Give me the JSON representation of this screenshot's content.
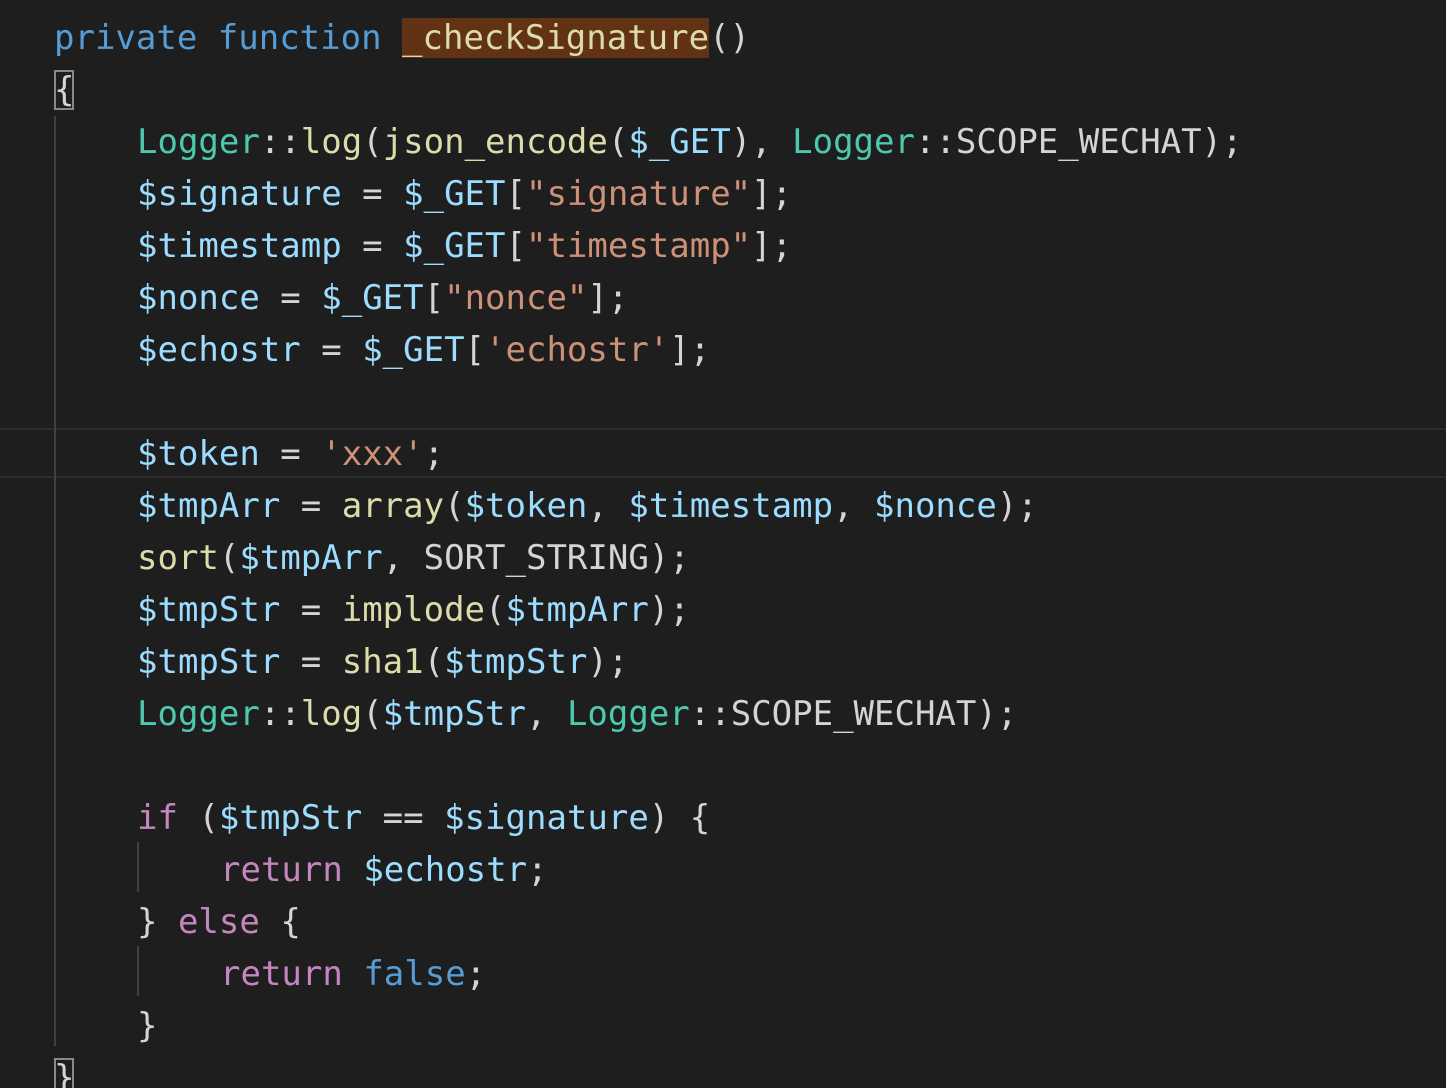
{
  "colors": {
    "background": "#1e1e1e",
    "keyword": "#569cd6",
    "control": "#c586c0",
    "function": "#dcdcaa",
    "variable": "#9cdcfe",
    "string": "#ce9178",
    "class": "#4ec9b0",
    "default": "#d4d4d4",
    "highlight": "#613214"
  },
  "lines": [
    {
      "indent": 0,
      "tokens": [
        {
          "t": "private",
          "c": "keyword"
        },
        {
          "t": " ",
          "c": "default"
        },
        {
          "t": "function",
          "c": "keyword"
        },
        {
          "t": " ",
          "c": "default"
        },
        {
          "t": "_checkSignature",
          "c": "function",
          "hl": true
        },
        {
          "t": "()",
          "c": "default"
        }
      ]
    },
    {
      "indent": 0,
      "tokens": [
        {
          "t": "{",
          "c": "default",
          "box": true
        }
      ]
    },
    {
      "indent": 1,
      "tokens": [
        {
          "t": "Logger",
          "c": "class"
        },
        {
          "t": "::",
          "c": "default"
        },
        {
          "t": "log",
          "c": "function"
        },
        {
          "t": "(",
          "c": "default"
        },
        {
          "t": "json_encode",
          "c": "function"
        },
        {
          "t": "(",
          "c": "default"
        },
        {
          "t": "$_GET",
          "c": "variable"
        },
        {
          "t": "), ",
          "c": "default"
        },
        {
          "t": "Logger",
          "c": "class"
        },
        {
          "t": "::",
          "c": "default"
        },
        {
          "t": "SCOPE_WECHAT",
          "c": "default"
        },
        {
          "t": ");",
          "c": "default"
        }
      ]
    },
    {
      "indent": 1,
      "tokens": [
        {
          "t": "$signature",
          "c": "variable"
        },
        {
          "t": " = ",
          "c": "default"
        },
        {
          "t": "$_GET",
          "c": "variable"
        },
        {
          "t": "[",
          "c": "default"
        },
        {
          "t": "\"signature\"",
          "c": "string"
        },
        {
          "t": "];",
          "c": "default"
        }
      ]
    },
    {
      "indent": 1,
      "tokens": [
        {
          "t": "$timestamp",
          "c": "variable"
        },
        {
          "t": " = ",
          "c": "default"
        },
        {
          "t": "$_GET",
          "c": "variable"
        },
        {
          "t": "[",
          "c": "default"
        },
        {
          "t": "\"timestamp\"",
          "c": "string"
        },
        {
          "t": "];",
          "c": "default"
        }
      ]
    },
    {
      "indent": 1,
      "tokens": [
        {
          "t": "$nonce",
          "c": "variable"
        },
        {
          "t": " = ",
          "c": "default"
        },
        {
          "t": "$_GET",
          "c": "variable"
        },
        {
          "t": "[",
          "c": "default"
        },
        {
          "t": "\"nonce\"",
          "c": "string"
        },
        {
          "t": "];",
          "c": "default"
        }
      ]
    },
    {
      "indent": 1,
      "tokens": [
        {
          "t": "$echostr",
          "c": "variable"
        },
        {
          "t": " = ",
          "c": "default"
        },
        {
          "t": "$_GET",
          "c": "variable"
        },
        {
          "t": "[",
          "c": "default"
        },
        {
          "t": "'echostr'",
          "c": "string"
        },
        {
          "t": "];",
          "c": "default"
        }
      ]
    },
    {
      "indent": 1,
      "tokens": []
    },
    {
      "indent": 1,
      "tokens": [
        {
          "t": "$token",
          "c": "variable"
        },
        {
          "t": " = ",
          "c": "default"
        },
        {
          "t": "'xxx'",
          "c": "string"
        },
        {
          "t": ";",
          "c": "default"
        }
      ]
    },
    {
      "indent": 1,
      "tokens": [
        {
          "t": "$tmpArr",
          "c": "variable"
        },
        {
          "t": " = ",
          "c": "default"
        },
        {
          "t": "array",
          "c": "function"
        },
        {
          "t": "(",
          "c": "default"
        },
        {
          "t": "$token",
          "c": "variable"
        },
        {
          "t": ", ",
          "c": "default"
        },
        {
          "t": "$timestamp",
          "c": "variable"
        },
        {
          "t": ", ",
          "c": "default"
        },
        {
          "t": "$nonce",
          "c": "variable"
        },
        {
          "t": ");",
          "c": "default"
        }
      ]
    },
    {
      "indent": 1,
      "tokens": [
        {
          "t": "sort",
          "c": "function"
        },
        {
          "t": "(",
          "c": "default"
        },
        {
          "t": "$tmpArr",
          "c": "variable"
        },
        {
          "t": ", ",
          "c": "default"
        },
        {
          "t": "SORT_STRING",
          "c": "default"
        },
        {
          "t": ");",
          "c": "default"
        }
      ]
    },
    {
      "indent": 1,
      "tokens": [
        {
          "t": "$tmpStr",
          "c": "variable"
        },
        {
          "t": " = ",
          "c": "default"
        },
        {
          "t": "implode",
          "c": "function"
        },
        {
          "t": "(",
          "c": "default"
        },
        {
          "t": "$tmpArr",
          "c": "variable"
        },
        {
          "t": ");",
          "c": "default"
        }
      ]
    },
    {
      "indent": 1,
      "tokens": [
        {
          "t": "$tmpStr",
          "c": "variable"
        },
        {
          "t": " = ",
          "c": "default"
        },
        {
          "t": "sha1",
          "c": "function"
        },
        {
          "t": "(",
          "c": "default"
        },
        {
          "t": "$tmpStr",
          "c": "variable"
        },
        {
          "t": ");",
          "c": "default"
        }
      ]
    },
    {
      "indent": 1,
      "tokens": [
        {
          "t": "Logger",
          "c": "class"
        },
        {
          "t": "::",
          "c": "default"
        },
        {
          "t": "log",
          "c": "function"
        },
        {
          "t": "(",
          "c": "default"
        },
        {
          "t": "$tmpStr",
          "c": "variable"
        },
        {
          "t": ", ",
          "c": "default"
        },
        {
          "t": "Logger",
          "c": "class"
        },
        {
          "t": "::",
          "c": "default"
        },
        {
          "t": "SCOPE_WECHAT",
          "c": "default"
        },
        {
          "t": ");",
          "c": "default"
        }
      ]
    },
    {
      "indent": 1,
      "tokens": []
    },
    {
      "indent": 1,
      "tokens": [
        {
          "t": "if",
          "c": "control"
        },
        {
          "t": " (",
          "c": "default"
        },
        {
          "t": "$tmpStr",
          "c": "variable"
        },
        {
          "t": " == ",
          "c": "default"
        },
        {
          "t": "$signature",
          "c": "variable"
        },
        {
          "t": ") {",
          "c": "default"
        }
      ]
    },
    {
      "indent": 2,
      "tokens": [
        {
          "t": "return",
          "c": "control"
        },
        {
          "t": " ",
          "c": "default"
        },
        {
          "t": "$echostr",
          "c": "variable"
        },
        {
          "t": ";",
          "c": "default"
        }
      ]
    },
    {
      "indent": 1,
      "tokens": [
        {
          "t": "} ",
          "c": "default"
        },
        {
          "t": "else",
          "c": "control"
        },
        {
          "t": " {",
          "c": "default"
        }
      ]
    },
    {
      "indent": 2,
      "tokens": [
        {
          "t": "return",
          "c": "control"
        },
        {
          "t": " ",
          "c": "default"
        },
        {
          "t": "false",
          "c": "keyword"
        },
        {
          "t": ";",
          "c": "default"
        }
      ]
    },
    {
      "indent": 1,
      "tokens": [
        {
          "t": "}",
          "c": "default"
        }
      ]
    },
    {
      "indent": 0,
      "tokens": [
        {
          "t": "}",
          "c": "default",
          "box": true
        }
      ]
    }
  ]
}
